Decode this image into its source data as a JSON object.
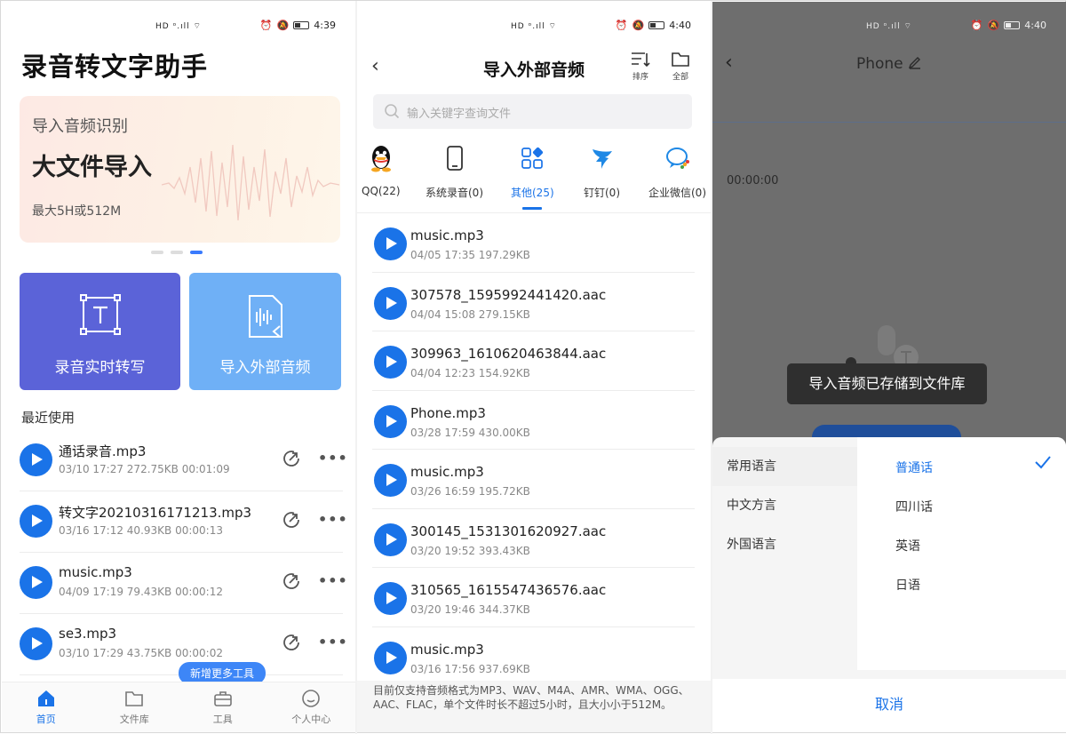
{
  "status": {
    "p1_time": "4:39",
    "p2_time": "4:40",
    "p3_time": "4:40"
  },
  "home": {
    "title": "录音转文字助手",
    "banner": {
      "line1": "导入音频识别",
      "line2": "大文件导入",
      "line3": "最大5H或512M"
    },
    "tile_record": "录音实时转写",
    "tile_import": "导入外部音频",
    "recent_title": "最近使用",
    "recent": [
      {
        "name": "通话录音.mp3",
        "meta": "03/10 17:27  272.75KB  00:01:09"
      },
      {
        "name": "转文字20210316171213.mp3",
        "meta": "03/16 17:12  40.93KB  00:00:13"
      },
      {
        "name": "music.mp3",
        "meta": "04/09 17:19  79.43KB  00:00:12"
      },
      {
        "name": "se3.mp3",
        "meta": "03/10 17:29  43.75KB  00:00:02"
      }
    ],
    "more_label": "•••",
    "pill": "新增更多工具",
    "tabs": [
      "首页",
      "文件库",
      "工具",
      "个人中心"
    ]
  },
  "importer": {
    "title": "导入外部音频",
    "sort_label": "排序",
    "all_label": "全部",
    "search_placeholder": "输入关键字查询文件",
    "sources": [
      "QQ(22)",
      "系统录音(0)",
      "其他(25)",
      "钉钉(0)",
      "企业微信(0)"
    ],
    "files": [
      {
        "name": "music.mp3",
        "meta": "04/05 17:35  197.29KB"
      },
      {
        "name": "307578_1595992441420.aac",
        "meta": "04/04 15:08  279.15KB"
      },
      {
        "name": "309963_1610620463844.aac",
        "meta": "04/04 12:23  154.92KB"
      },
      {
        "name": "Phone.mp3",
        "meta": "03/28 17:59  430.00KB"
      },
      {
        "name": "music.mp3",
        "meta": "03/26 16:59  195.72KB"
      },
      {
        "name": "300145_1531301620927.aac",
        "meta": "03/20 19:52  393.43KB"
      },
      {
        "name": "310565_1615547436576.aac",
        "meta": "03/20 19:46  344.37KB"
      },
      {
        "name": "music.mp3",
        "meta": "03/16 17:56  937.69KB"
      }
    ],
    "note": "目前仅支持音频格式为MP3、WAV、M4A、AMR、WMA、OGG、AAC、FLAC，单个文件时长不超过5小时，且大小小于512M。"
  },
  "transcribe": {
    "title": "Phone",
    "time": "00:00:00",
    "toast": "导入音频已存储到文件库",
    "categories": [
      "常用语言",
      "中文方言",
      "外国语言"
    ],
    "options": [
      "普通话",
      "四川话",
      "英语",
      "日语"
    ],
    "cancel": "取消"
  },
  "colors": {
    "accent": "#1a73e8",
    "tile_record": "#5b63d8",
    "tile_import": "#6fb0f6"
  }
}
